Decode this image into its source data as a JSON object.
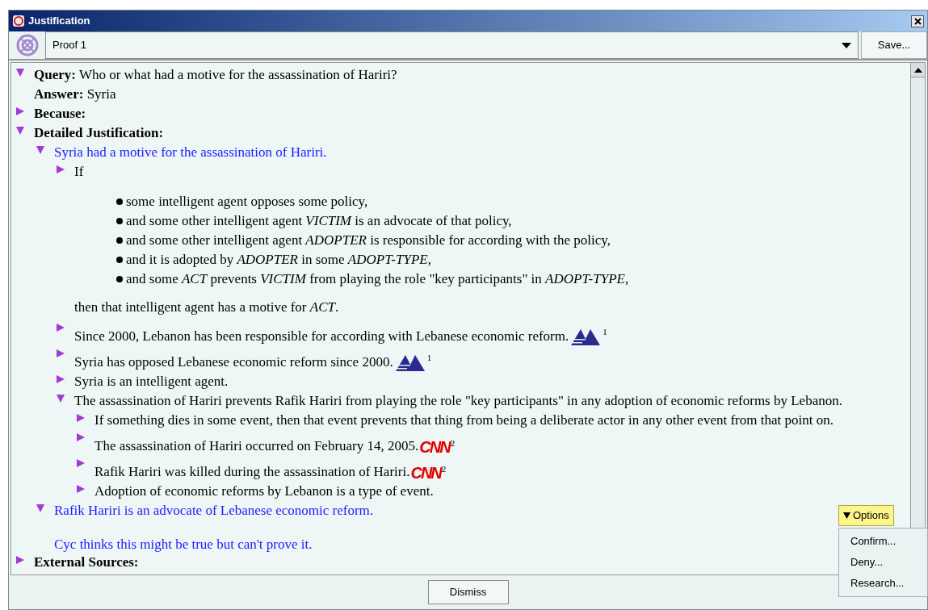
{
  "window": {
    "title": "Justification"
  },
  "proof_select": {
    "value": "Proof 1"
  },
  "save_button": "Save...",
  "tree": [
    {
      "kind": "heading",
      "label": "Query:",
      "text": "Who or what had a motive for the assassination of Hariri?",
      "expanded": true,
      "answer": {
        "label": "Answer:",
        "text": "Syria"
      }
    },
    {
      "kind": "heading",
      "label": "Because:",
      "expanded": false
    },
    {
      "kind": "heading",
      "label": "Detailed Justification:",
      "expanded": true,
      "children": [
        {
          "kind": "conclusion",
          "text": "Syria had a motive for the assassination of Hariri.",
          "expanded": true,
          "children": [
            {
              "text": "If",
              "expanded": false,
              "conditions": [
                "some intelligent agent opposes some policy,",
                "and some other intelligent agent *VICTIM* is an advocate of that policy,",
                "and some other intelligent agent *ADOPTER* is responsible for according with the policy,",
                "and it is adopted by *ADOPTER* in some *ADOPT-TYPE*,",
                "and some *ACT* prevents *VICTIM* from playing the role \"key participants\" in *ADOPT-TYPE*,"
              ],
              "then": "then that intelligent agent has a motive for *ACT*."
            },
            {
              "text": "Since 2000, Lebanon has been responsible for according with Lebanese economic reform.",
              "expanded": false,
              "source": {
                "kind": "triangles",
                "note": "1"
              }
            },
            {
              "text": "Syria has opposed Lebanese economic reform since 2000.",
              "expanded": false,
              "source": {
                "kind": "triangles",
                "note": "1"
              }
            },
            {
              "text": "Syria is an intelligent agent.",
              "expanded": false
            },
            {
              "text": "The assassination of Hariri prevents Rafik Hariri from playing the role \"key participants\" in any adoption of economic reforms by Lebanon.",
              "expanded": true,
              "children": [
                {
                  "text": "If something dies in some event, then that event prevents that thing from being a deliberate actor in any other event from that point on.",
                  "expanded": false
                },
                {
                  "text": "The assassination of Hariri occurred on February 14, 2005.",
                  "expanded": false,
                  "source": {
                    "kind": "wordmark",
                    "label": "CNN",
                    "note": "2"
                  }
                },
                {
                  "text": "Rafik Hariri was killed during the assassination of Hariri.",
                  "expanded": false,
                  "source": {
                    "kind": "wordmark",
                    "label": "CNN",
                    "note": "2"
                  }
                },
                {
                  "text": "Adoption of economic reforms by Lebanon is a type of event.",
                  "expanded": false
                }
              ]
            }
          ]
        },
        {
          "kind": "conclusion",
          "text": "Rafik Hariri is an advocate of Lebanese economic reform.",
          "expanded": true,
          "note": "Cyc thinks this might be true but can't prove it."
        }
      ]
    },
    {
      "kind": "heading",
      "label": "External Sources:",
      "expanded": false
    }
  ],
  "options_menu": {
    "button": "Options",
    "items": [
      "Confirm...",
      "Deny...",
      "Research..."
    ]
  },
  "dismiss_button": "Dismiss"
}
